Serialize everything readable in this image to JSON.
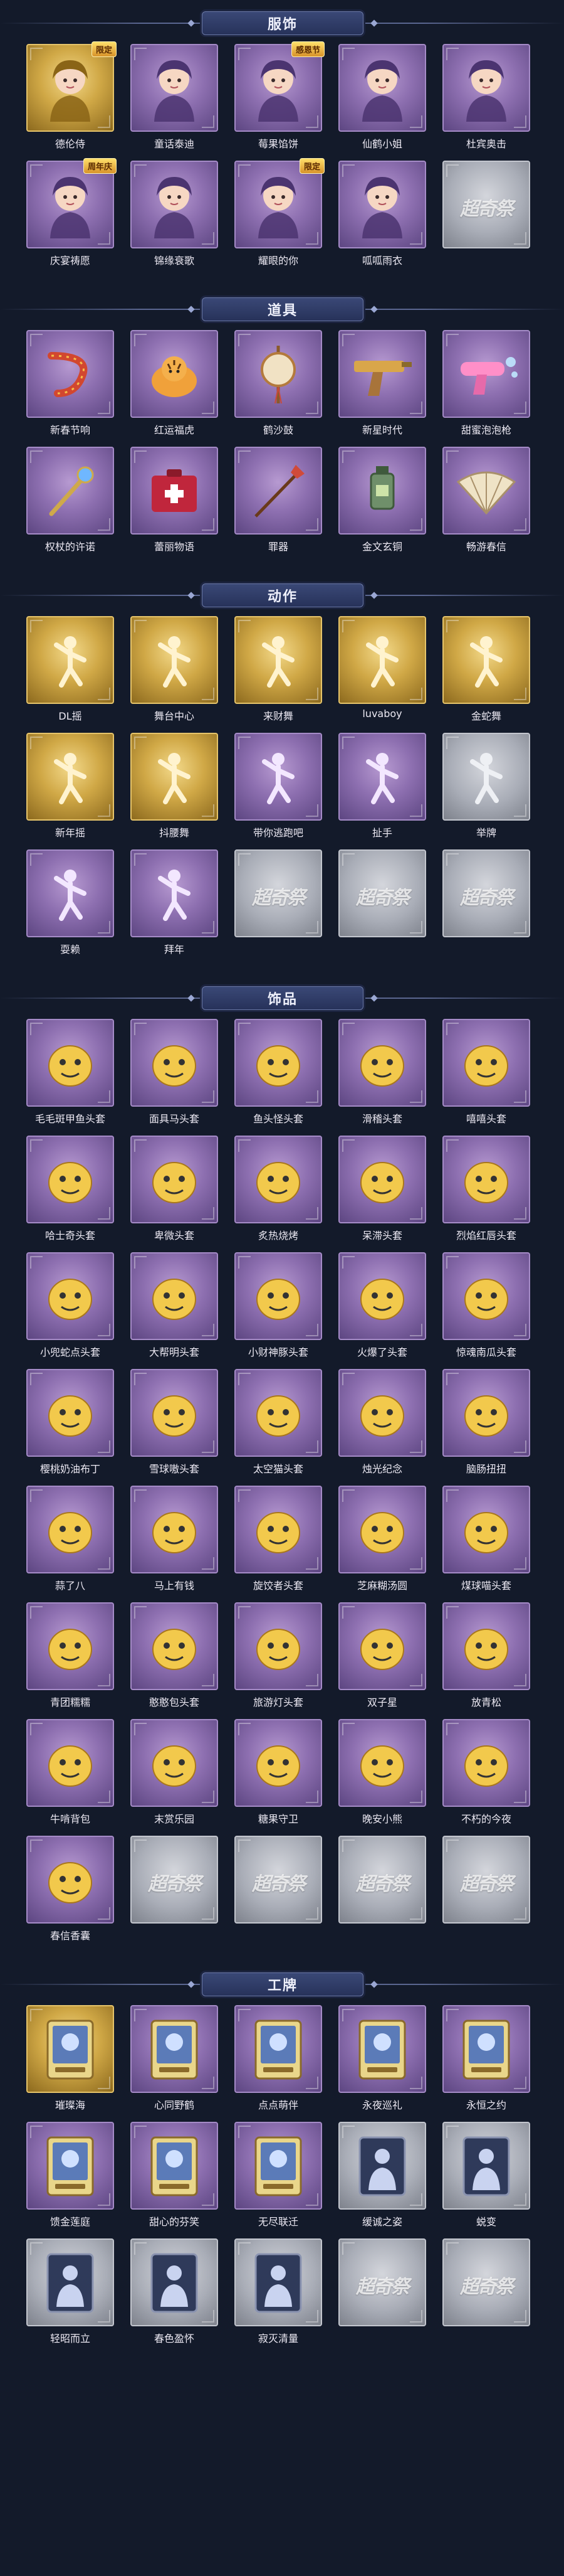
{
  "watermark": "超奇祭",
  "colors": {
    "background": "#131a2a",
    "purple": "#8d6fb0",
    "gold": "#d0a846",
    "grey": "#a9adb7"
  },
  "sections": [
    {
      "title": "服饰",
      "items": [
        {
          "label": "德伦侍",
          "rarity": "gold",
          "icon": "character-portrait-icon",
          "badge": "限定"
        },
        {
          "label": "童话泰迪",
          "rarity": "purple",
          "icon": "character-portrait-icon"
        },
        {
          "label": "莓果馅饼",
          "rarity": "purple",
          "icon": "character-portrait-icon",
          "badge": "感恩节"
        },
        {
          "label": "仙鹤小姐",
          "rarity": "purple",
          "icon": "character-portrait-icon"
        },
        {
          "label": "杜宾奥击",
          "rarity": "purple",
          "icon": "character-portrait-icon"
        },
        {
          "label": "庆宴祷愿",
          "rarity": "purple",
          "icon": "character-portrait-icon",
          "badge": "周年庆"
        },
        {
          "label": "锦缘衰歌",
          "rarity": "purple",
          "icon": "character-portrait-icon"
        },
        {
          "label": "耀眼的你",
          "rarity": "purple",
          "icon": "character-portrait-icon",
          "badge": "限定"
        },
        {
          "label": "呱呱雨衣",
          "rarity": "purple",
          "icon": "character-portrait-icon"
        },
        {
          "label": "",
          "rarity": "grey",
          "icon": "locked-placeholder"
        }
      ]
    },
    {
      "title": "道具",
      "items": [
        {
          "label": "新春节响",
          "rarity": "purple",
          "icon": "firecracker-icon"
        },
        {
          "label": "红运福虎",
          "rarity": "purple",
          "icon": "tiger-icon"
        },
        {
          "label": "鹤沙鼓",
          "rarity": "purple",
          "icon": "drum-icon"
        },
        {
          "label": "新星时代",
          "rarity": "purple",
          "icon": "pistol-icon"
        },
        {
          "label": "甜蜜泡泡枪",
          "rarity": "purple",
          "icon": "bubble-gun-icon"
        },
        {
          "label": "权杖的许诺",
          "rarity": "purple",
          "icon": "scepter-icon"
        },
        {
          "label": "蕾丽物语",
          "rarity": "purple",
          "icon": "medkit-icon"
        },
        {
          "label": "罪器",
          "rarity": "purple",
          "icon": "spear-icon"
        },
        {
          "label": "金文玄铜",
          "rarity": "purple",
          "icon": "lantern-icon"
        },
        {
          "label": "畅游春信",
          "rarity": "purple",
          "icon": "fan-icon"
        }
      ]
    },
    {
      "title": "动作",
      "items": [
        {
          "label": "DL摇",
          "rarity": "gold",
          "icon": "dance-pose-icon"
        },
        {
          "label": "舞台中心",
          "rarity": "gold",
          "icon": "dance-pose-icon"
        },
        {
          "label": "来财舞",
          "rarity": "gold",
          "icon": "dance-pose-icon"
        },
        {
          "label": "luvaboy",
          "rarity": "gold",
          "icon": "dance-pose-icon"
        },
        {
          "label": "金蛇舞",
          "rarity": "gold",
          "icon": "dance-pose-icon"
        },
        {
          "label": "新年摇",
          "rarity": "gold",
          "icon": "dance-pose-icon"
        },
        {
          "label": "抖腰舞",
          "rarity": "gold",
          "icon": "dance-pose-icon"
        },
        {
          "label": "带你逃跑吧",
          "rarity": "purple",
          "icon": "dance-pose-icon"
        },
        {
          "label": "扯手",
          "rarity": "purple",
          "icon": "dance-pose-icon"
        },
        {
          "label": "举牌",
          "rarity": "grey",
          "icon": "dance-pose-icon"
        },
        {
          "label": "耍赖",
          "rarity": "purple",
          "icon": "dance-pose-icon"
        },
        {
          "label": "拜年",
          "rarity": "purple",
          "icon": "dance-pose-icon"
        },
        {
          "label": "",
          "rarity": "grey",
          "icon": "locked-placeholder"
        },
        {
          "label": "",
          "rarity": "grey",
          "icon": "locked-placeholder"
        },
        {
          "label": "",
          "rarity": "grey",
          "icon": "locked-placeholder"
        }
      ]
    },
    {
      "title": "饰品",
      "items": [
        {
          "label": "毛毛斑甲鱼头套",
          "rarity": "purple",
          "icon": "head-accessory-icon"
        },
        {
          "label": "面具马头套",
          "rarity": "purple",
          "icon": "head-accessory-icon"
        },
        {
          "label": "鱼头怪头套",
          "rarity": "purple",
          "icon": "head-accessory-icon"
        },
        {
          "label": "滑稽头套",
          "rarity": "purple",
          "icon": "head-accessory-icon"
        },
        {
          "label": "嘻嘻头套",
          "rarity": "purple",
          "icon": "head-accessory-icon"
        },
        {
          "label": "哈士奇头套",
          "rarity": "purple",
          "icon": "head-accessory-icon"
        },
        {
          "label": "卑微头套",
          "rarity": "purple",
          "icon": "head-accessory-icon"
        },
        {
          "label": "炙热烧烤",
          "rarity": "purple",
          "icon": "head-accessory-icon"
        },
        {
          "label": "呆滞头套",
          "rarity": "purple",
          "icon": "head-accessory-icon"
        },
        {
          "label": "烈焰红唇头套",
          "rarity": "purple",
          "icon": "head-accessory-icon"
        },
        {
          "label": "小兜蛇点头套",
          "rarity": "purple",
          "icon": "head-accessory-icon"
        },
        {
          "label": "大帮明头套",
          "rarity": "purple",
          "icon": "head-accessory-icon"
        },
        {
          "label": "小财神豚头套",
          "rarity": "purple",
          "icon": "head-accessory-icon"
        },
        {
          "label": "火爆了头套",
          "rarity": "purple",
          "icon": "head-accessory-icon"
        },
        {
          "label": "惊魂南瓜头套",
          "rarity": "purple",
          "icon": "head-accessory-icon"
        },
        {
          "label": "樱桃奶油布丁",
          "rarity": "purple",
          "icon": "head-accessory-icon"
        },
        {
          "label": "雪球嗷头套",
          "rarity": "purple",
          "icon": "head-accessory-icon"
        },
        {
          "label": "太空猫头套",
          "rarity": "purple",
          "icon": "head-accessory-icon"
        },
        {
          "label": "烛光纪念",
          "rarity": "purple",
          "icon": "head-accessory-icon"
        },
        {
          "label": "脑肠扭扭",
          "rarity": "purple",
          "icon": "head-accessory-icon"
        },
        {
          "label": "蒜了八",
          "rarity": "purple",
          "icon": "head-accessory-icon"
        },
        {
          "label": "马上有钱",
          "rarity": "purple",
          "icon": "head-accessory-icon"
        },
        {
          "label": "旋饺者头套",
          "rarity": "purple",
          "icon": "head-accessory-icon"
        },
        {
          "label": "芝麻糊汤圆",
          "rarity": "purple",
          "icon": "head-accessory-icon"
        },
        {
          "label": "煤球喵头套",
          "rarity": "purple",
          "icon": "head-accessory-icon"
        },
        {
          "label": "青团糯糯",
          "rarity": "purple",
          "icon": "head-accessory-icon"
        },
        {
          "label": "憨憨包头套",
          "rarity": "purple",
          "icon": "head-accessory-icon"
        },
        {
          "label": "旅游灯头套",
          "rarity": "purple",
          "icon": "head-accessory-icon"
        },
        {
          "label": "双子星",
          "rarity": "purple",
          "icon": "head-accessory-icon"
        },
        {
          "label": "放青松",
          "rarity": "purple",
          "icon": "head-accessory-icon"
        },
        {
          "label": "牛啃背包",
          "rarity": "purple",
          "icon": "head-accessory-icon"
        },
        {
          "label": "末赏乐园",
          "rarity": "purple",
          "icon": "head-accessory-icon"
        },
        {
          "label": "糖果守卫",
          "rarity": "purple",
          "icon": "head-accessory-icon"
        },
        {
          "label": "晚安小熊",
          "rarity": "purple",
          "icon": "head-accessory-icon"
        },
        {
          "label": "不朽的今夜",
          "rarity": "purple",
          "icon": "head-accessory-icon"
        },
        {
          "label": "春信香囊",
          "rarity": "purple",
          "icon": "head-accessory-icon"
        },
        {
          "label": "",
          "rarity": "grey",
          "icon": "locked-placeholder"
        },
        {
          "label": "",
          "rarity": "grey",
          "icon": "locked-placeholder"
        },
        {
          "label": "",
          "rarity": "grey",
          "icon": "locked-placeholder"
        },
        {
          "label": "",
          "rarity": "grey",
          "icon": "locked-placeholder"
        }
      ]
    },
    {
      "title": "工牌",
      "items": [
        {
          "label": "璀璨海",
          "rarity": "gold",
          "icon": "badge-card-icon"
        },
        {
          "label": "心同野鹤",
          "rarity": "purple",
          "icon": "badge-card-icon"
        },
        {
          "label": "点点萌伴",
          "rarity": "purple",
          "icon": "badge-card-icon"
        },
        {
          "label": "永夜巡礼",
          "rarity": "purple",
          "icon": "badge-card-icon"
        },
        {
          "label": "永恒之约",
          "rarity": "purple",
          "icon": "badge-card-icon"
        },
        {
          "label": "馈金莲庭",
          "rarity": "purple",
          "icon": "badge-card-icon"
        },
        {
          "label": "甜心的芬笑",
          "rarity": "purple",
          "icon": "badge-card-icon"
        },
        {
          "label": "无尽联迁",
          "rarity": "purple",
          "icon": "badge-card-icon"
        },
        {
          "label": "缓诚之姿",
          "rarity": "grey",
          "icon": "badge-silhouette-icon"
        },
        {
          "label": "蜕变",
          "rarity": "grey",
          "icon": "badge-silhouette-icon"
        },
        {
          "label": "轻昭而立",
          "rarity": "grey",
          "icon": "badge-silhouette-icon"
        },
        {
          "label": "春色盈怀",
          "rarity": "grey",
          "icon": "badge-silhouette-icon"
        },
        {
          "label": "寂灭清量",
          "rarity": "grey",
          "icon": "badge-silhouette-icon"
        },
        {
          "label": "",
          "rarity": "grey",
          "icon": "locked-placeholder"
        },
        {
          "label": "",
          "rarity": "grey",
          "icon": "locked-placeholder"
        }
      ]
    }
  ]
}
